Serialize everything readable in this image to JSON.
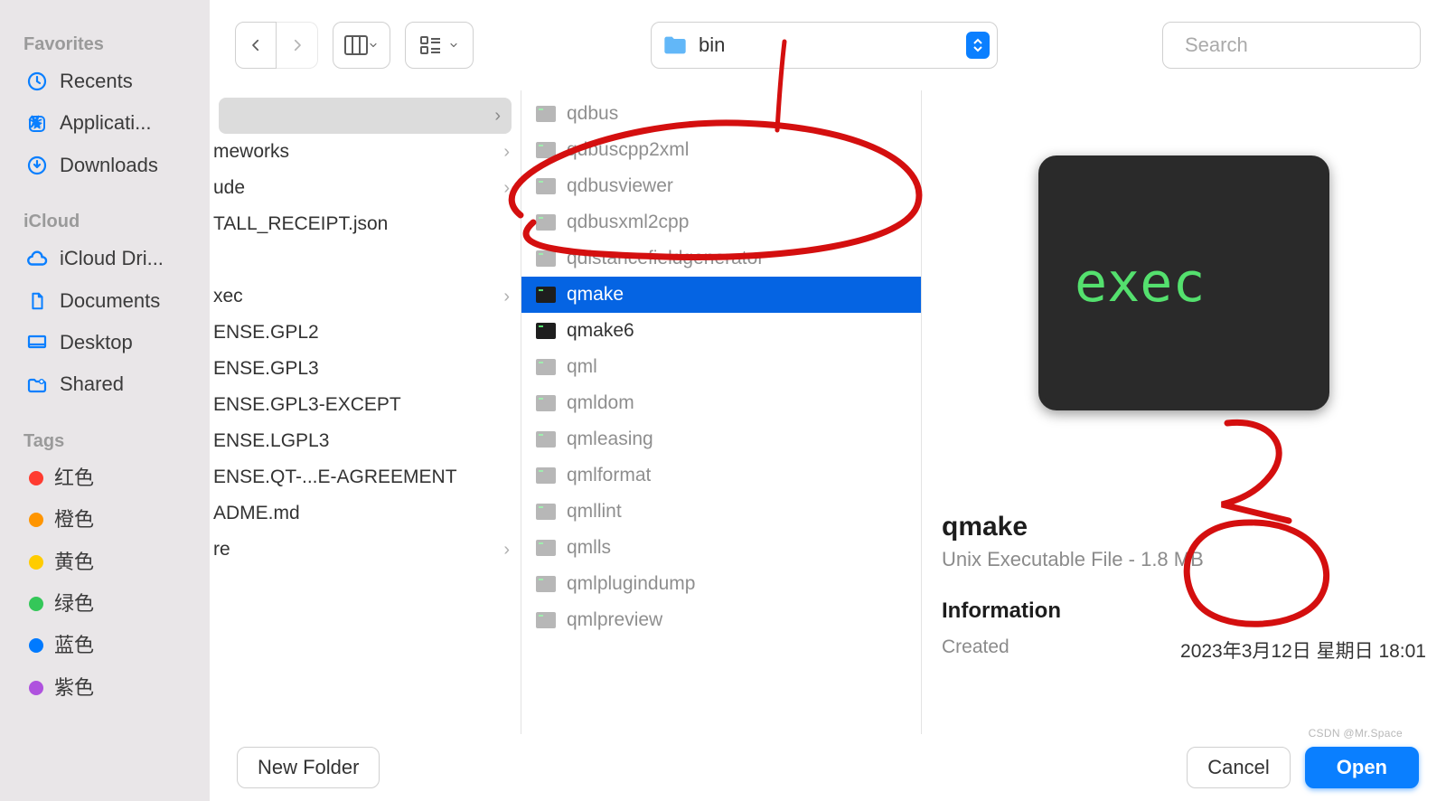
{
  "sidebar": {
    "favorites_label": "Favorites",
    "favorites": [
      {
        "name": "Recents",
        "icon": "clock"
      },
      {
        "name": "Applicati...",
        "icon": "app"
      },
      {
        "name": "Downloads",
        "icon": "download"
      }
    ],
    "icloud_label": "iCloud",
    "icloud": [
      {
        "name": "iCloud Dri...",
        "icon": "cloud"
      },
      {
        "name": "Documents",
        "icon": "doc"
      },
      {
        "name": "Desktop",
        "icon": "desktop"
      },
      {
        "name": "Shared",
        "icon": "shared"
      }
    ],
    "tags_label": "Tags",
    "tags": [
      {
        "name": "红色",
        "color": "#ff3b30"
      },
      {
        "name": "橙色",
        "color": "#ff9500"
      },
      {
        "name": "黄色",
        "color": "#ffcc00"
      },
      {
        "name": "绿色",
        "color": "#34c759"
      },
      {
        "name": "蓝色",
        "color": "#007aff"
      },
      {
        "name": "紫色",
        "color": "#af52de"
      }
    ]
  },
  "toolbar": {
    "path_title": "bin",
    "search_placeholder": "Search"
  },
  "col1": [
    {
      "label": "",
      "selected": true,
      "chev": true
    },
    {
      "label": "meworks",
      "chev": true
    },
    {
      "label": "ude",
      "chev": true
    },
    {
      "label": "TALL_RECEIPT.json"
    },
    {
      "label": ""
    },
    {
      "label": "xec",
      "chev": true
    },
    {
      "label": "ENSE.GPL2"
    },
    {
      "label": "ENSE.GPL3"
    },
    {
      "label": "ENSE.GPL3-EXCEPT"
    },
    {
      "label": "ENSE.LGPL3"
    },
    {
      "label": "ENSE.QT-...E-AGREEMENT"
    },
    {
      "label": "ADME.md"
    },
    {
      "label": "re",
      "chev": true
    }
  ],
  "col2": [
    {
      "label": "qdbus",
      "dim": true
    },
    {
      "label": "qdbuscpp2xml",
      "dim": true
    },
    {
      "label": "qdbusviewer",
      "dim": true
    },
    {
      "label": "qdbusxml2cpp",
      "dim": true
    },
    {
      "label": "qdistancefieldgenerator",
      "dim": true
    },
    {
      "label": "qmake",
      "selected": true
    },
    {
      "label": "qmake6",
      "dark": true
    },
    {
      "label": "qml",
      "dim": true
    },
    {
      "label": "qmldom",
      "dim": true
    },
    {
      "label": "qmleasing",
      "dim": true
    },
    {
      "label": "qmlformat",
      "dim": true
    },
    {
      "label": "qmllint",
      "dim": true
    },
    {
      "label": "qmlls",
      "dim": true
    },
    {
      "label": "qmlplugindump",
      "dim": true
    },
    {
      "label": "qmlpreview",
      "dim": true
    }
  ],
  "preview": {
    "thumb_label": "exec",
    "title": "qmake",
    "subtitle": "Unix Executable File - 1.8 MB",
    "info_heading": "Information",
    "created_label": "Created",
    "created_value": "2023年3月12日 星期日 18:01"
  },
  "footer": {
    "new_folder": "New Folder",
    "cancel": "Cancel",
    "open": "Open"
  },
  "watermark": "CSDN @Mr.Space"
}
